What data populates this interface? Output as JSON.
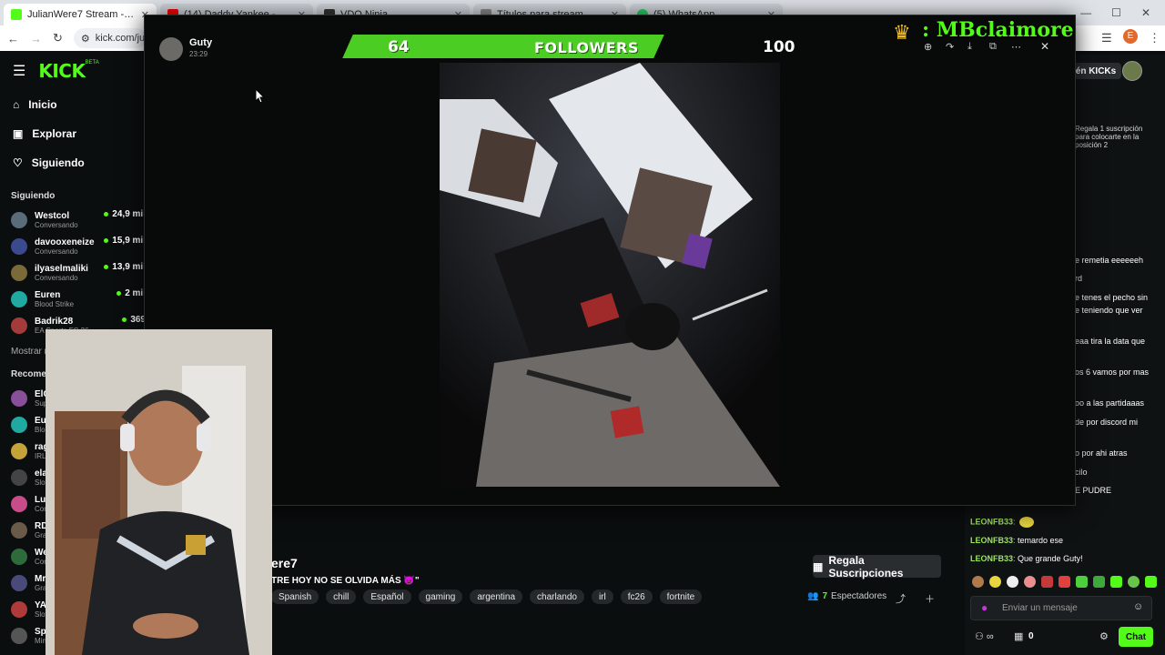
{
  "browser": {
    "tabs": [
      {
        "label": "JulianWere7 Stream - Watch Li",
        "active": true
      },
      {
        "label": "(14) Daddy Yankee - Limbo",
        "active": false
      },
      {
        "label": "VDO.Ninja",
        "active": false
      },
      {
        "label": "Títulos para stream",
        "active": false
      },
      {
        "label": "(5) WhatsApp",
        "active": false
      }
    ],
    "address": "kick.com/juli"
  },
  "kick": {
    "logo": "KICK",
    "logo_beta": "BETA",
    "nav": [
      "Inicio",
      "Explorar",
      "Siguiendo"
    ],
    "following_title": "Siguiendo",
    "following": [
      {
        "name": "Westcol",
        "game": "Conversando",
        "count": "24,9 mil"
      },
      {
        "name": "davooxeneize",
        "game": "Conversando",
        "count": "15,9 mil"
      },
      {
        "name": "ilyaselmaliki",
        "game": "Conversando",
        "count": "13,9 mil"
      },
      {
        "name": "Euren",
        "game": "Blood Strike",
        "count": "2 mil"
      },
      {
        "name": "Badrik28",
        "game": "EA Sports FC 26",
        "count": "369"
      }
    ],
    "show_more": "Mostrar más",
    "recommended_title": "Recomendados",
    "recommended": [
      {
        "name": "ElG",
        "game": "Sup"
      },
      {
        "name": "Eur",
        "game": "Blo"
      },
      {
        "name": "rag",
        "game": "IRL"
      },
      {
        "name": "ela",
        "game": "Slot"
      },
      {
        "name": "Lui",
        "game": "Cor"
      },
      {
        "name": "RD",
        "game": "Gra"
      },
      {
        "name": "We",
        "game": "Cor"
      },
      {
        "name": "Mrs",
        "game": "Gra"
      },
      {
        "name": "YA",
        "game": "Slot"
      },
      {
        "name": "Spr",
        "game": "Min"
      }
    ]
  },
  "modal": {
    "author": "Guty",
    "time": "23:29",
    "followers_current": "64",
    "followers_label": "FOLLOWERS",
    "followers_goal": "100",
    "progress": 0.64,
    "overlay_name": ": MBclaimore"
  },
  "stream": {
    "channel_fragment": "ere7",
    "title_fragment": "TRE HOY NO SE OLVIDA MÁS 😈\"",
    "tags": [
      "Spanish",
      "chill",
      "Español",
      "gaming",
      "argentina",
      "charlando",
      "irl",
      "fc26",
      "fortnite"
    ],
    "viewers_count": "7",
    "viewers_label": "Espectadores",
    "gift_button": "Regala Suscripciones"
  },
  "chat": {
    "header_button": "én KICKs",
    "gift_note": "Regala 1 suscripción para colocarte en la posición 2",
    "fragments": [
      "e remetia eeeeeeh",
      "rd",
      "e tenes el pecho sin",
      "e teniendo que ver",
      "eaa tira la data que",
      "os 6 vamos por mas",
      "oo a las partidaaas",
      "de por discord mi",
      "o por ahi atras",
      "cilo",
      "E PUDRE"
    ],
    "messages": [
      {
        "user": "LEONFB33",
        "text": ""
      },
      {
        "user": "LEONFB33",
        "text": "temardo ese"
      },
      {
        "user": "LEONFB33",
        "text": "Que grande Guty!"
      }
    ],
    "input_placeholder": "Enviar un mensaje",
    "send_button": "Chat",
    "points": "0"
  }
}
